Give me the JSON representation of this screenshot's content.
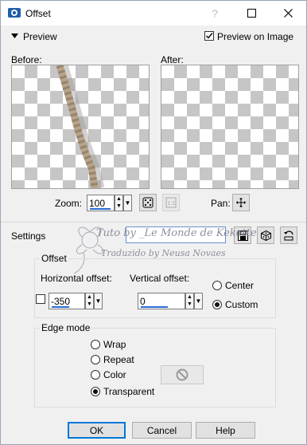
{
  "window": {
    "title": "Offset",
    "icon": "paint-shop-pro-icon",
    "controls": [
      "help-icon",
      "maximize-icon",
      "close-icon"
    ]
  },
  "preview": {
    "collapse_label": "Preview",
    "preview_on_image_label": "Preview on Image",
    "preview_on_image_checked": true,
    "before_label": "Before:",
    "after_label": "After:",
    "zoom_label": "Zoom:",
    "zoom_value": "100",
    "pan_label": "Pan:"
  },
  "settings": {
    "label": "Settings",
    "preset_value": ""
  },
  "offset": {
    "group_title": "Offset",
    "horizontal_label": "Horizontal offset:",
    "horizontal_value": "-350",
    "vertical_label": "Vertical offset:",
    "vertical_value": "0",
    "center_label": "Center",
    "custom_label": "Custom",
    "selected": "Custom"
  },
  "edge_mode": {
    "group_title": "Edge mode",
    "options": [
      "Wrap",
      "Repeat",
      "Color",
      "Transparent"
    ],
    "selected": "Transparent",
    "color_swatch": "#e8e8e8"
  },
  "buttons": {
    "ok": "OK",
    "cancel": "Cancel",
    "help": "Help"
  },
  "watermark": {
    "line1": "Tuto by _Le Monde de Kekette",
    "line2": "Traduzido by Neusa Novaes"
  }
}
